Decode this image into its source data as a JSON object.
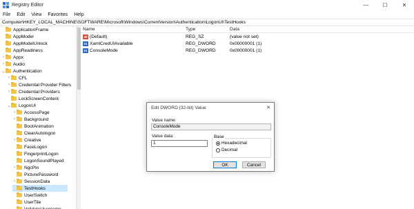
{
  "window": {
    "title": "Registry Editor"
  },
  "menu": [
    "File",
    "Edit",
    "View",
    "Favorites",
    "Help"
  ],
  "address": "Computer\\HKEY_LOCAL_MACHINE\\SOFTWARE\\Microsoft\\Windows\\CurrentVersion\\Authentication\\LogonUI\\TestHooks",
  "tree": [
    {
      "label": "ApplicationFrame",
      "depth": 0,
      "chev": ""
    },
    {
      "label": "AppModel",
      "depth": 0,
      "chev": ""
    },
    {
      "label": "AppModelUnlock",
      "depth": 0,
      "chev": ""
    },
    {
      "label": "AppReadiness",
      "depth": 0,
      "chev": ""
    },
    {
      "label": "Appx",
      "depth": 0,
      "chev": "›"
    },
    {
      "label": "Audio",
      "depth": 0,
      "chev": "›"
    },
    {
      "label": "Authentication",
      "depth": 0,
      "chev": "⌄"
    },
    {
      "label": "CFL",
      "depth": 1,
      "chev": "›"
    },
    {
      "label": "Credential Provider Filters",
      "depth": 1,
      "chev": "›"
    },
    {
      "label": "Credential Providers",
      "depth": 1,
      "chev": "›"
    },
    {
      "label": "LockScreenContent",
      "depth": 1,
      "chev": ""
    },
    {
      "label": "LogonUI",
      "depth": 1,
      "chev": "⌄"
    },
    {
      "label": "AccessPage",
      "depth": 2,
      "chev": "›"
    },
    {
      "label": "Background",
      "depth": 2,
      "chev": "›"
    },
    {
      "label": "BootAnimation",
      "depth": 2,
      "chev": ""
    },
    {
      "label": "ClearAutologon",
      "depth": 2,
      "chev": ""
    },
    {
      "label": "Creative",
      "depth": 2,
      "chev": "›"
    },
    {
      "label": "FaceLogon",
      "depth": 2,
      "chev": ""
    },
    {
      "label": "FingerprintLogon",
      "depth": 2,
      "chev": ""
    },
    {
      "label": "LogonSoundPlayed",
      "depth": 2,
      "chev": ""
    },
    {
      "label": "NgcPin",
      "depth": 2,
      "chev": "›"
    },
    {
      "label": "PicturePassword",
      "depth": 2,
      "chev": ""
    },
    {
      "label": "SessionData",
      "depth": 2,
      "chev": "›"
    },
    {
      "label": "TestHooks",
      "depth": 2,
      "chev": "",
      "selected": true
    },
    {
      "label": "UserSwitch",
      "depth": 2,
      "chev": ""
    },
    {
      "label": "UserTile",
      "depth": 2,
      "chev": ""
    },
    {
      "label": "ValidateUsername",
      "depth": 2,
      "chev": ""
    }
  ],
  "list": {
    "headers": {
      "name": "Name",
      "type": "Type",
      "data": "Data"
    },
    "rows": [
      {
        "name": "(Default)",
        "type": "REG_SZ",
        "data": "(value not set)",
        "icon": "string-value-icon"
      },
      {
        "name": "XamlCredUIAvailable",
        "type": "REG_DWORD",
        "data": "0x00000001 (1)",
        "icon": "dword-value-icon"
      },
      {
        "name": "ConsoleMode",
        "type": "REG_DWORD",
        "data": "0x00000001 (1)",
        "icon": "dword-value-icon"
      }
    ]
  },
  "dialog": {
    "title": "Edit DWORD (32-bit) Value",
    "value_name_label": "Value name:",
    "value_name": "ConsoleMode",
    "value_data_label": "Value data:",
    "value_data": "1",
    "base_label": "Base",
    "hex_label": "Hexadecimal",
    "dec_label": "Decimal",
    "selected_base": "Hexadecimal",
    "ok_label": "OK",
    "cancel_label": "Cancel"
  },
  "icons": {
    "close": "✕",
    "minimize": "—",
    "maximize": "☐"
  },
  "colors": {
    "selection": "#cce8ff",
    "folder": "#f0c64a",
    "accent": "#0078d7"
  }
}
